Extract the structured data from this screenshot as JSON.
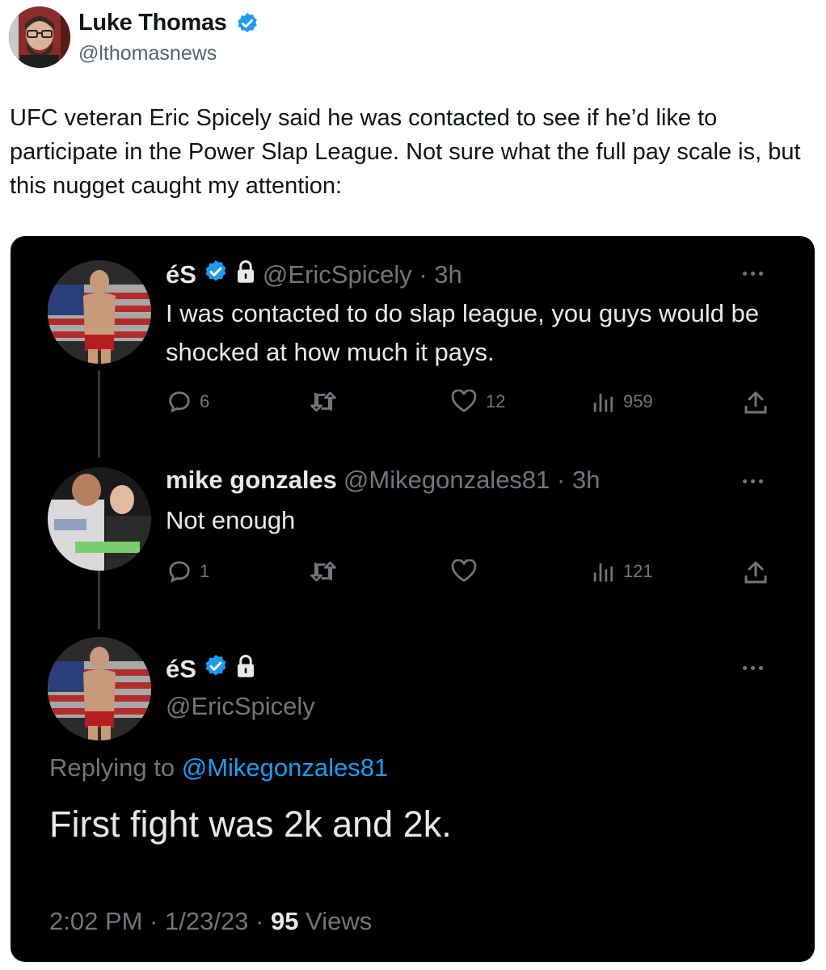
{
  "outer": {
    "name": "Luke Thomas",
    "handle": "@lthomasnews",
    "text": "UFC veteran Eric Spicely said he was contacted to see if he’d like to participate in the Power Slap League. Not sure what the full pay scale is, but this nugget caught my attention:"
  },
  "embed": {
    "tweet1": {
      "name": "éS",
      "handle": "@EricSpicely · 3h",
      "text": "I was contacted to do slap league, you guys would be shocked at how much it pays.",
      "replies": "6",
      "likes": "12",
      "views": "959"
    },
    "tweet2": {
      "name": "mike gonzales",
      "handle": "@Mikegonzales81 · 3h",
      "text": "Not enough",
      "replies": "1",
      "views": "121"
    },
    "tweet3": {
      "name": "éS",
      "handle": "@EricSpicely",
      "replying_prefix": "Replying to ",
      "replying_to": "@Mikegonzales81",
      "text": "First fight was 2k and 2k.",
      "timestamp": "2:02 PM · 1/23/23 · ",
      "views_count": "95",
      "views_label": " Views"
    }
  },
  "colors": {
    "verified": "#1d9bf0",
    "card_bg": "#000000",
    "muted": "#71767b",
    "link": "#1d9bf0"
  },
  "icons": [
    "verified-badge-icon",
    "lock-icon",
    "reply-icon",
    "retweet-icon",
    "like-icon",
    "views-icon",
    "share-icon",
    "more-icon"
  ]
}
